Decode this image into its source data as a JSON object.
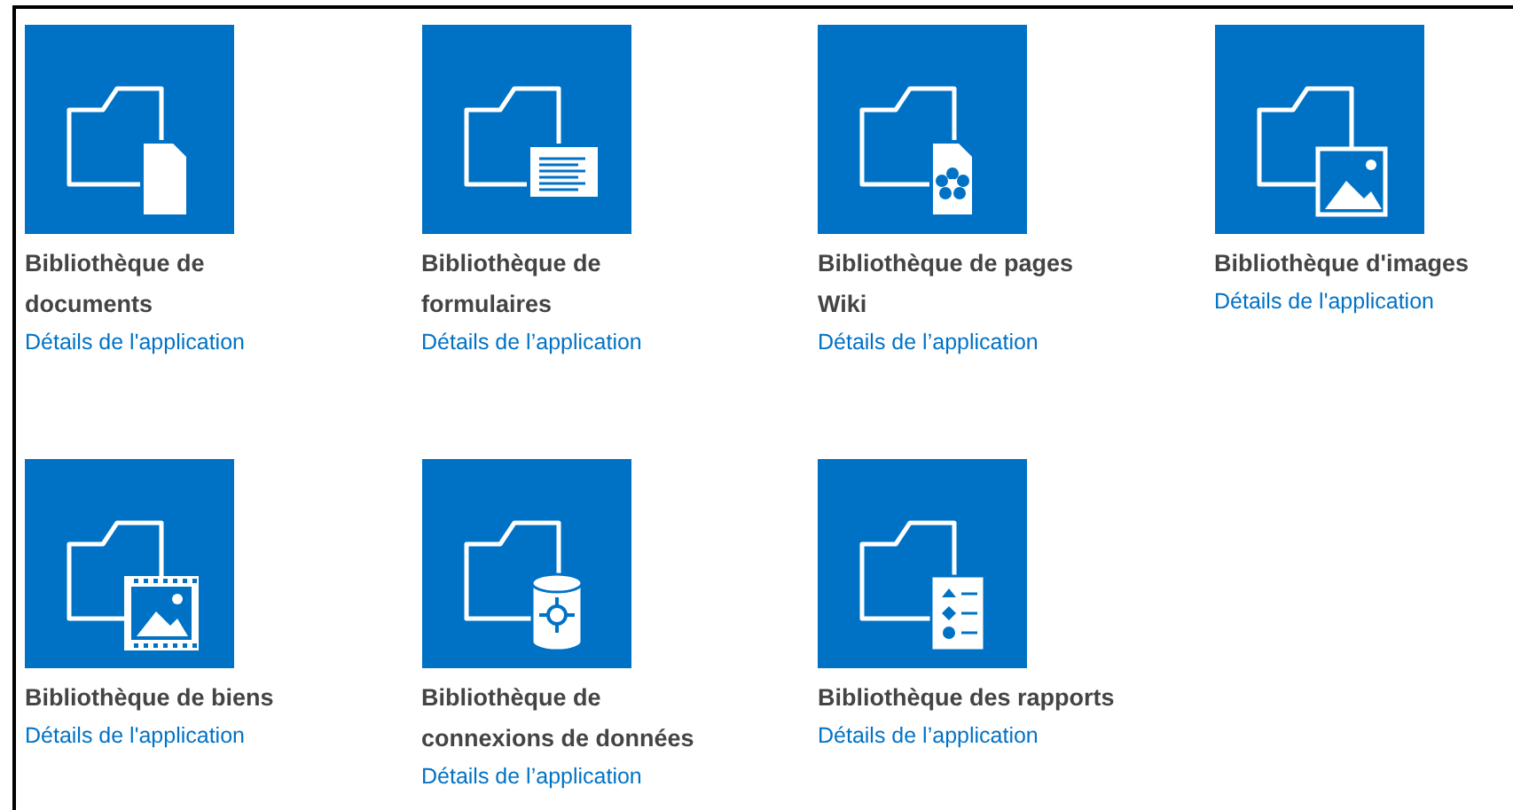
{
  "apps": [
    {
      "kind": "document",
      "title_lines": [
        "Bibliothèque de",
        "documents"
      ],
      "link": "Détails de l'application"
    },
    {
      "kind": "form",
      "title_lines": [
        "Bibliothèque de",
        "formulaires"
      ],
      "link": "Détails de l’application"
    },
    {
      "kind": "wiki",
      "title_lines": [
        "Bibliothèque de pages",
        "Wiki"
      ],
      "link": "Détails de l’application"
    },
    {
      "kind": "image",
      "title_lines": [
        "Bibliothèque d'images"
      ],
      "link": "Détails de l'application"
    },
    {
      "kind": "asset",
      "title_lines": [
        "Bibliothèque de biens"
      ],
      "link": "Détails de l'application"
    },
    {
      "kind": "data",
      "title_lines": [
        "Bibliothèque de",
        "connexions de données"
      ],
      "link": "Détails de l’application"
    },
    {
      "kind": "report",
      "title_lines": [
        "Bibliothèque des rapports"
      ],
      "link": "Détails de l’application"
    }
  ]
}
